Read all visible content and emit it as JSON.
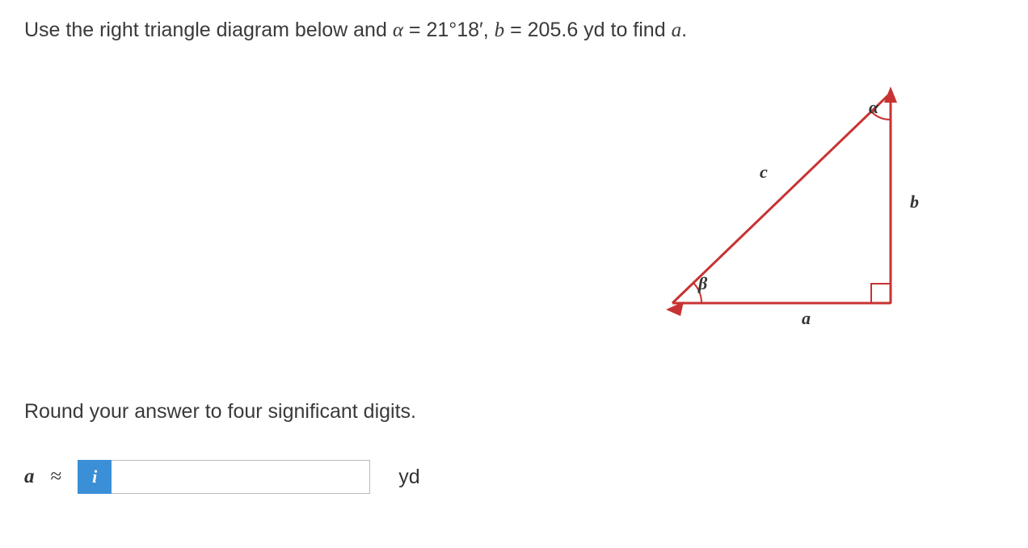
{
  "question": {
    "prefix": "Use the right triangle diagram below and ",
    "alpha_sym": "α",
    "eq1": " = ",
    "alpha_val": "21°18′",
    "comma": ", ",
    "b_sym": "b",
    "eq2": " = ",
    "b_val": "205.6",
    "suffix": " yd to find ",
    "a_sym": "a",
    "period": "."
  },
  "diagram": {
    "alpha": "α",
    "beta": "β",
    "a": "a",
    "b": "b",
    "c": "c"
  },
  "instruction": "Round your answer to four significant digits.",
  "answer": {
    "var": "a",
    "approx": "≈",
    "info": "i",
    "value": "",
    "placeholder": "",
    "unit": "yd"
  }
}
